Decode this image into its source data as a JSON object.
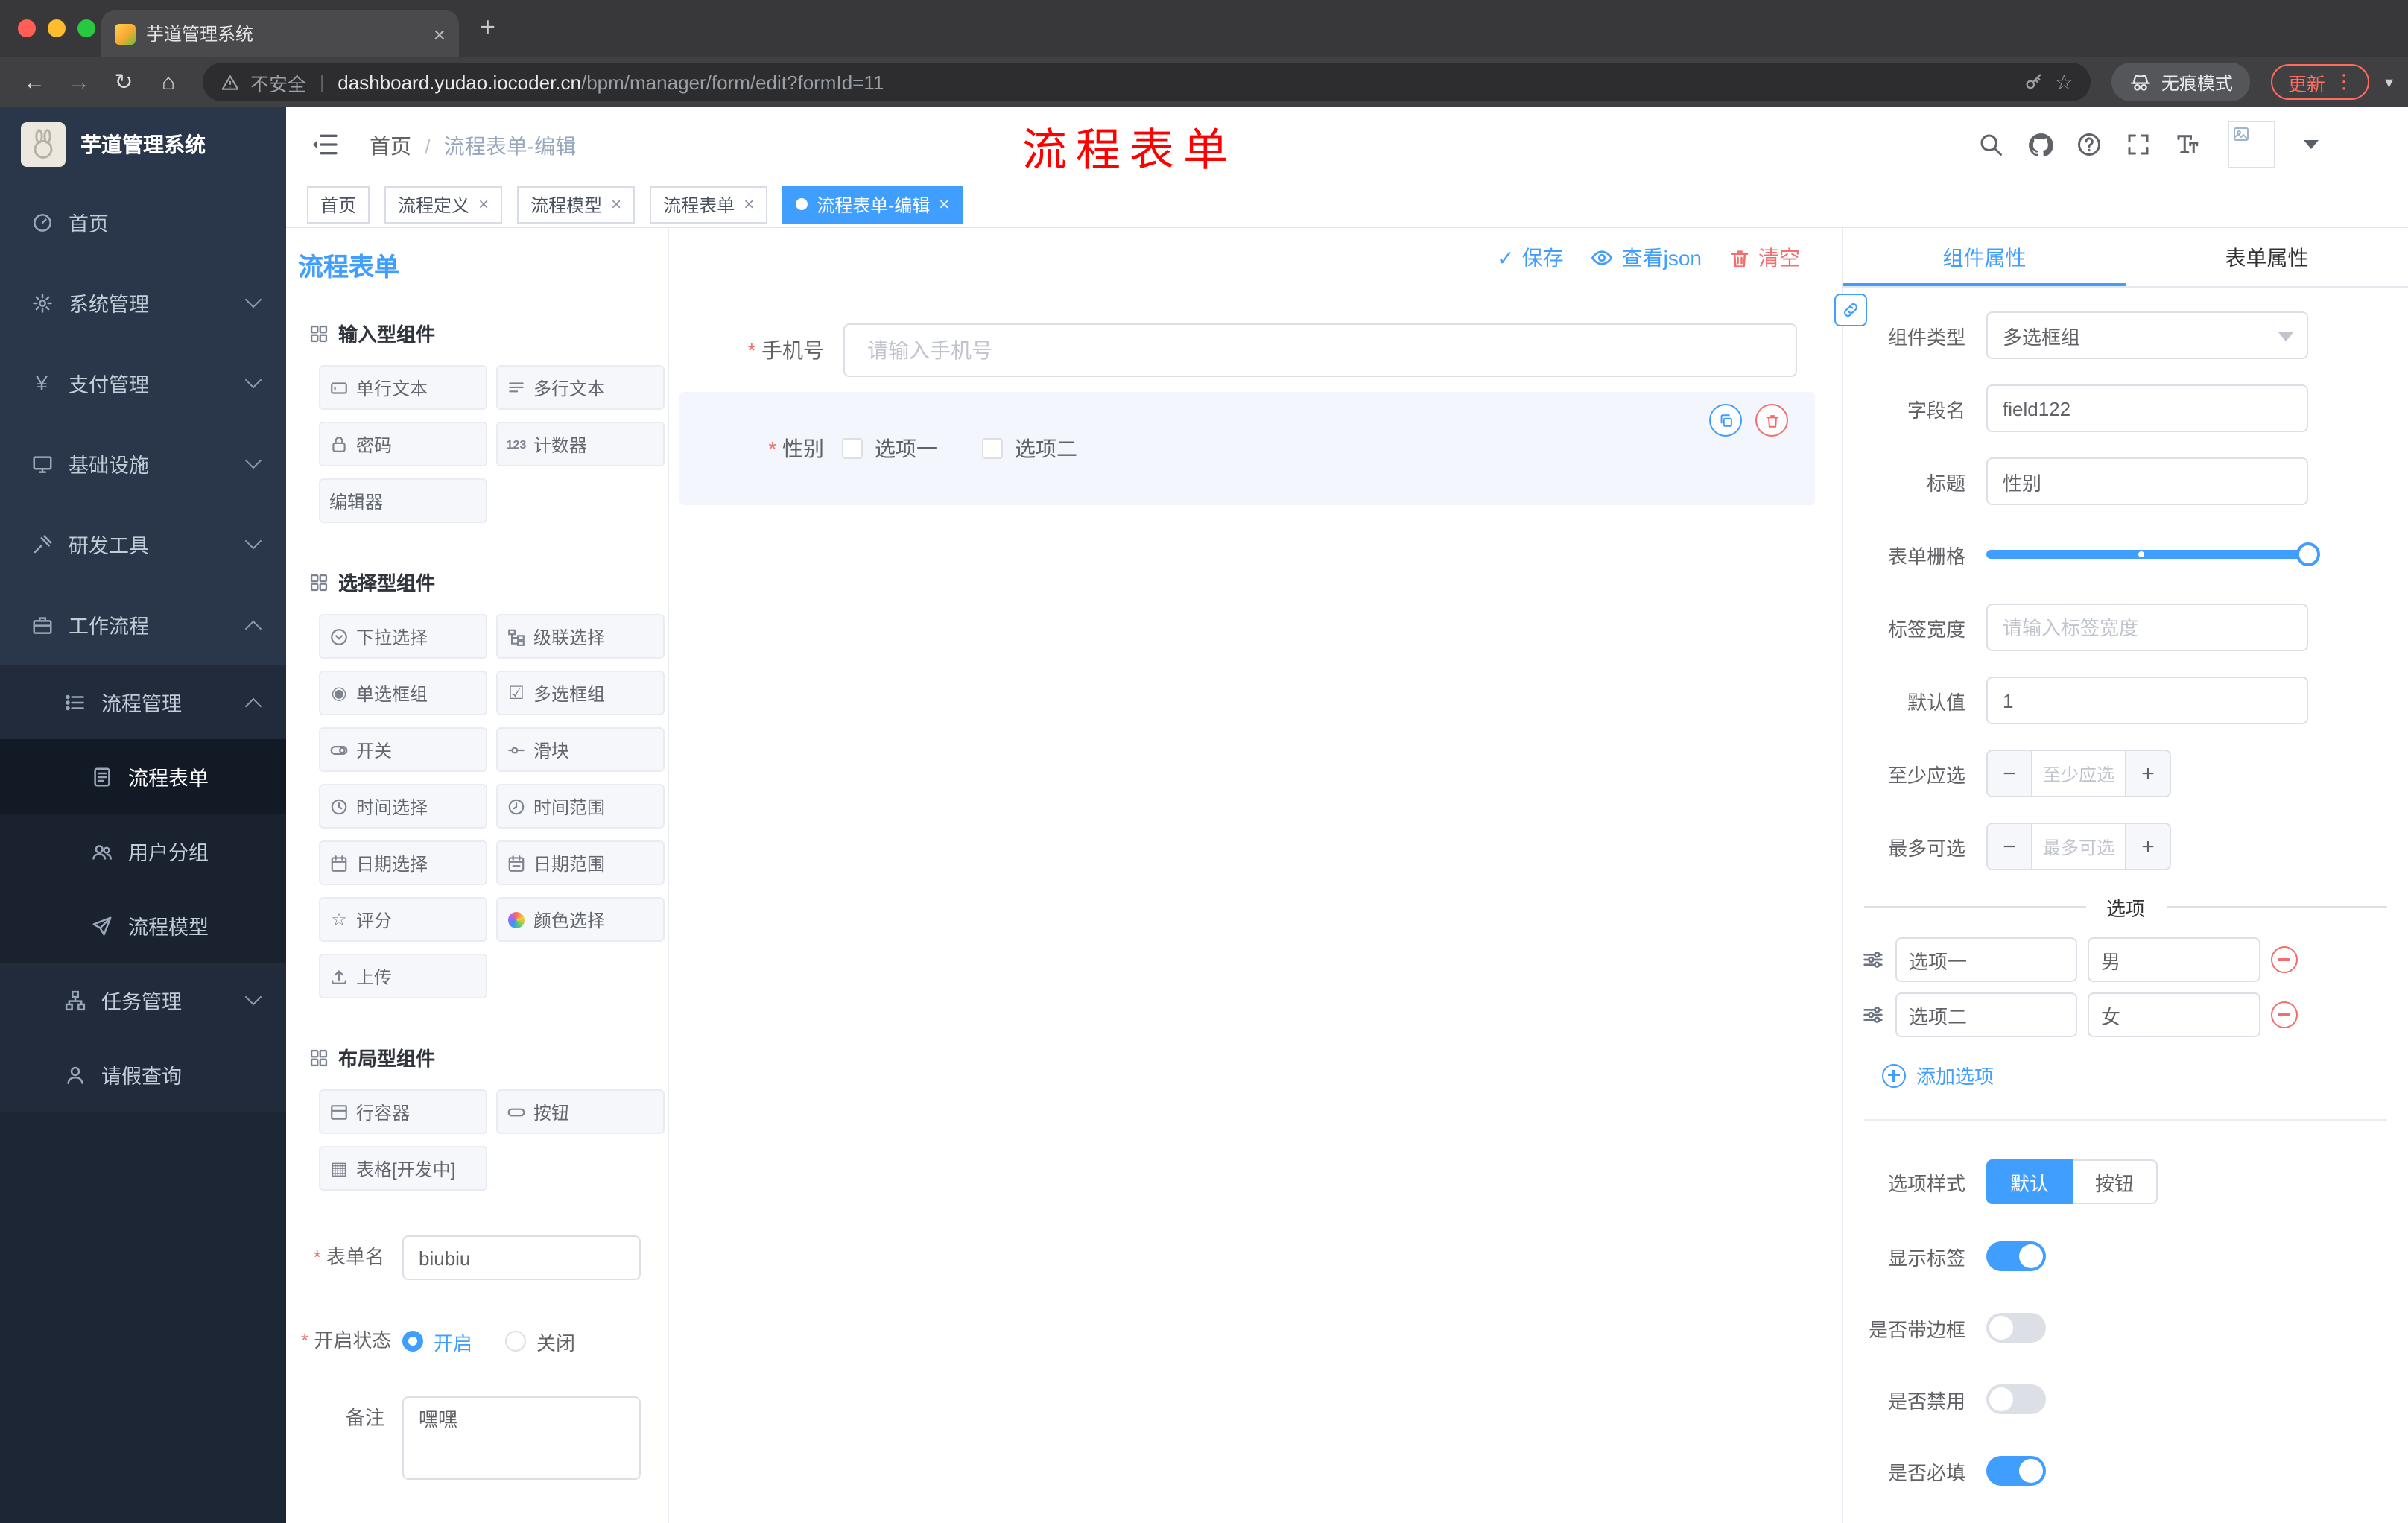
{
  "browser": {
    "tab_title": "芋道管理系统",
    "security_label": "不安全",
    "url_domain": "dashboard.yudao.iocoder.cn",
    "url_path": "/bpm/manager/form/edit?formId=11",
    "incognito_label": "无痕模式",
    "update_label": "更新"
  },
  "sidebar": {
    "app_title": "芋道管理系统",
    "items": [
      {
        "label": "首页"
      },
      {
        "label": "系统管理"
      },
      {
        "label": "支付管理"
      },
      {
        "label": "基础设施"
      },
      {
        "label": "研发工具"
      },
      {
        "label": "工作流程"
      },
      {
        "label": "流程管理"
      },
      {
        "label": "流程表单"
      },
      {
        "label": "用户分组"
      },
      {
        "label": "流程模型"
      },
      {
        "label": "任务管理"
      },
      {
        "label": "请假查询"
      }
    ]
  },
  "header": {
    "breadcrumb_home": "首页",
    "breadcrumb_current": "流程表单-编辑",
    "annotation": "流程表单"
  },
  "tags": [
    {
      "label": "首页"
    },
    {
      "label": "流程定义"
    },
    {
      "label": "流程模型"
    },
    {
      "label": "流程表单"
    },
    {
      "label": "流程表单-编辑"
    }
  ],
  "designer": {
    "panel_title": "流程表单",
    "toolbar": {
      "save": "保存",
      "view_json": "查看json",
      "clear": "清空"
    },
    "counter_icon_text": "123",
    "groups": [
      {
        "title": "输入型组件",
        "items": [
          "单行文本",
          "多行文本",
          "密码",
          "计数器",
          "编辑器"
        ]
      },
      {
        "title": "选择型组件",
        "items": [
          "下拉选择",
          "级联选择",
          "单选框组",
          "多选框组",
          "开关",
          "滑块",
          "时间选择",
          "时间范围",
          "日期选择",
          "日期范围",
          "评分",
          "颜色选择",
          "上传"
        ]
      },
      {
        "title": "布局型组件",
        "items": [
          "行容器",
          "按钮",
          "表格[开发中]"
        ]
      }
    ],
    "meta": {
      "form_name_label": "表单名",
      "form_name_value": "biubiu",
      "status_label": "开启状态",
      "status_on": "开启",
      "status_off": "关闭",
      "remark_label": "备注",
      "remark_value": "嘿嘿"
    },
    "canvas": {
      "phone_label": "手机号",
      "phone_placeholder": "请输入手机号",
      "gender_label": "性别",
      "gender_option1": "选项一",
      "gender_option2": "选项二"
    }
  },
  "properties": {
    "tab_component": "组件属性",
    "tab_form": "表单属性",
    "component_type_label": "组件类型",
    "component_type_value": "多选框组",
    "field_name_label": "字段名",
    "field_name_value": "field122",
    "title_label": "标题",
    "title_value": "性别",
    "grid_label": "表单栅格",
    "label_width_label": "标签宽度",
    "label_width_placeholder": "请输入标签宽度",
    "default_label": "默认值",
    "default_value": "1",
    "min_label": "至少应选",
    "min_placeholder": "至少应选",
    "max_label": "最多可选",
    "max_placeholder": "最多可选",
    "options_title": "选项",
    "option_rows": [
      {
        "label": "选项一",
        "value": "男"
      },
      {
        "label": "选项二",
        "value": "女"
      }
    ],
    "add_option_label": "添加选项",
    "style_label": "选项样式",
    "style_options": [
      "默认",
      "按钮"
    ],
    "style_selected": "默认",
    "switches": [
      {
        "label": "显示标签",
        "on": true
      },
      {
        "label": "是否带边框",
        "on": false
      },
      {
        "label": "是否禁用",
        "on": false
      },
      {
        "label": "是否必填",
        "on": true
      }
    ]
  },
  "colors": {
    "primary": "#409eff",
    "danger": "#f56c6c",
    "annotation": "#ff0000"
  }
}
